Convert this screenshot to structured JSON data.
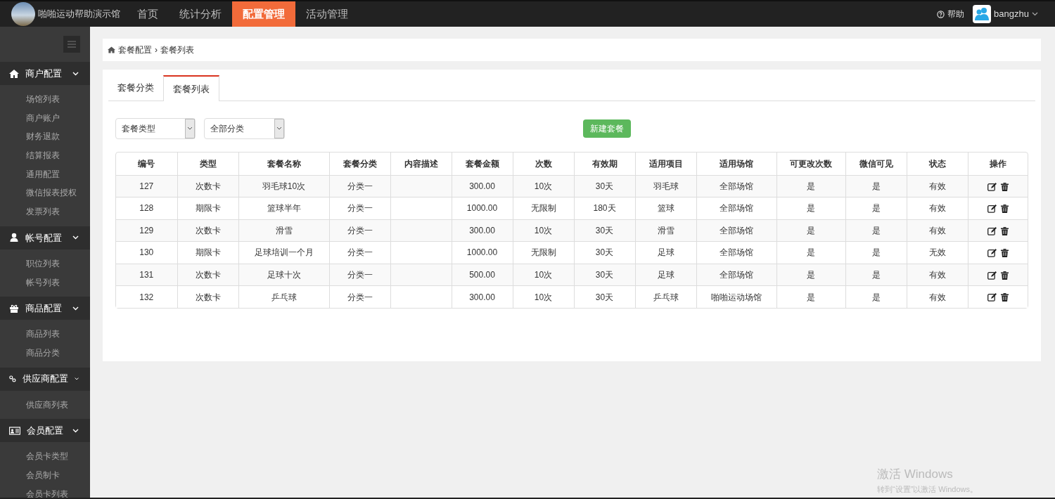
{
  "brand": {
    "title": "啪啪运动帮助演示馆"
  },
  "nav": [
    {
      "label": "首页",
      "selected": false
    },
    {
      "label": "统计分析",
      "selected": false
    },
    {
      "label": "配置管理",
      "selected": true
    },
    {
      "label": "活动管理",
      "selected": false
    }
  ],
  "header_right": {
    "help": "帮助",
    "user": "bangzhu"
  },
  "sidebar": [
    {
      "label": "商户配置",
      "expanded": true,
      "children": [
        {
          "label": "场馆列表"
        },
        {
          "label": "商户账户"
        },
        {
          "label": "财务退款"
        },
        {
          "label": "结算报表"
        },
        {
          "label": "通用配置"
        },
        {
          "label": "微信报表授权"
        },
        {
          "label": "发票列表"
        }
      ]
    },
    {
      "label": "帐号配置",
      "expanded": true,
      "children": [
        {
          "label": "职位列表"
        },
        {
          "label": "帐号列表"
        }
      ]
    },
    {
      "label": "商品配置",
      "expanded": true,
      "children": [
        {
          "label": "商品列表"
        },
        {
          "label": "商品分类"
        }
      ]
    },
    {
      "label": "供应商配置",
      "expanded": true,
      "children": [
        {
          "label": "供应商列表"
        }
      ]
    },
    {
      "label": "会员配置",
      "expanded": true,
      "children": [
        {
          "label": "会员卡类型"
        },
        {
          "label": "会员制卡"
        },
        {
          "label": "会员卡列表"
        }
      ]
    }
  ],
  "breadcrumb": {
    "separator": "›",
    "items": [
      "套餐配置",
      "套餐列表"
    ]
  },
  "tabs": [
    {
      "label": "套餐分类",
      "selected": false
    },
    {
      "label": "套餐列表",
      "selected": true
    }
  ],
  "filters": [
    {
      "value": "套餐类型"
    },
    {
      "value": "全部分类"
    }
  ],
  "new_button": "新建套餐",
  "table": {
    "columns": [
      "编号",
      "类型",
      "套餐名称",
      "套餐分类",
      "内容描述",
      "套餐金额",
      "次数",
      "有效期",
      "适用项目",
      "适用场馆",
      "可更改次数",
      "微信可见",
      "状态",
      "操作"
    ],
    "rows": [
      [
        "127",
        "次数卡",
        "羽毛球10次",
        "分类一",
        "",
        "300.00",
        "10次",
        "30天",
        "羽毛球",
        "全部场馆",
        "是",
        "是",
        "有效"
      ],
      [
        "128",
        "期限卡",
        "篮球半年",
        "分类一",
        "",
        "1000.00",
        "无限制",
        "180天",
        "篮球",
        "全部场馆",
        "是",
        "是",
        "有效"
      ],
      [
        "129",
        "次数卡",
        "滑雪",
        "分类一",
        "",
        "300.00",
        "10次",
        "30天",
        "滑雪",
        "全部场馆",
        "是",
        "是",
        "有效"
      ],
      [
        "130",
        "期限卡",
        "足球培训一个月",
        "分类一",
        "",
        "1000.00",
        "无限制",
        "30天",
        "足球",
        "全部场馆",
        "是",
        "是",
        "无效"
      ],
      [
        "131",
        "次数卡",
        "足球十次",
        "分类一",
        "",
        "500.00",
        "10次",
        "30天",
        "足球",
        "全部场馆",
        "是",
        "是",
        "有效"
      ],
      [
        "132",
        "次数卡",
        "乒乓球",
        "分类一",
        "",
        "300.00",
        "10次",
        "30天",
        "乒乓球",
        "啪啪运动场馆",
        "是",
        "是",
        "有效"
      ]
    ]
  },
  "os_overlay": {
    "title": "激活 Windows",
    "subtitle": "转到“设置”以激活 Windows。"
  }
}
